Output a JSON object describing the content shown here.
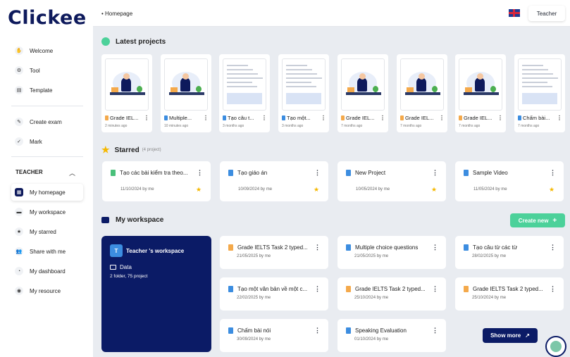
{
  "brand": {
    "logo": "Clickee"
  },
  "sidebar": {
    "top_items": [
      {
        "label": "Welcome",
        "icon": "hand-icon"
      },
      {
        "label": "Tool",
        "icon": "tool-icon"
      },
      {
        "label": "Template",
        "icon": "template-icon"
      }
    ],
    "mid_items": [
      {
        "label": "Create exam",
        "icon": "exam-icon"
      },
      {
        "label": "Mark",
        "icon": "mark-icon"
      }
    ],
    "section_title": "TEACHER",
    "teacher_items": [
      {
        "label": "My homepage",
        "icon": "grid-icon"
      },
      {
        "label": "My workspace",
        "icon": "folder-icon"
      },
      {
        "label": "My starred",
        "icon": "star-icon"
      },
      {
        "label": "Share with me",
        "icon": "users-icon"
      },
      {
        "label": "My dashboard",
        "icon": "chart-icon"
      },
      {
        "label": "My resource",
        "icon": "resource-icon"
      }
    ]
  },
  "header": {
    "breadcrumb": "Homepage",
    "role": "Teacher"
  },
  "latest": {
    "title": "Latest projects",
    "items": [
      {
        "name": "Grade IEL...",
        "time": "2 minutes ago",
        "color": "#f4a94b"
      },
      {
        "name": "Multiple...",
        "time": "10 minutes ago",
        "color": "#3c8de0"
      },
      {
        "name": "Tạo câu t...",
        "time": "3 months ago",
        "color": "#3c8de0"
      },
      {
        "name": "Tạo một...",
        "time": "3 months ago",
        "color": "#3c8de0"
      },
      {
        "name": "Grade IEL...",
        "time": "7 months ago",
        "color": "#f4a94b"
      },
      {
        "name": "Grade IEL...",
        "time": "7 months ago",
        "color": "#f4a94b"
      },
      {
        "name": "Grade IEL...",
        "time": "7 months ago",
        "color": "#f4a94b"
      },
      {
        "name": "Chấm bài...",
        "time": "7 months ago",
        "color": "#3c8de0"
      }
    ]
  },
  "starred": {
    "title": "Starred",
    "count": "(4 project)",
    "items": [
      {
        "name": "Tạo các bài kiểm tra theo...",
        "date": "11/10/2024 by me",
        "color": "#49c07a"
      },
      {
        "name": "Tạo giáo án",
        "date": "10/09/2024 by me",
        "color": "#3c8de0"
      },
      {
        "name": "New Project",
        "date": "10/05/2024 by me",
        "color": "#3c8de0"
      },
      {
        "name": "Sample Video",
        "date": "11/05/2024 by me",
        "color": "#3c8de0"
      }
    ]
  },
  "workspace": {
    "title": "My workspace",
    "create_label": "Create new",
    "show_more_label": "Show more",
    "card": {
      "avatar": "T",
      "title": "Teacher 's workspace",
      "folder": "Data",
      "count": "2 folder, 75 project"
    },
    "items": [
      {
        "name": "Grade IELTS Task 2 typed...",
        "date": "21/05/2025 by me",
        "color": "#f4a94b"
      },
      {
        "name": "Multiple choice questions",
        "date": "21/05/2025 by me",
        "color": "#3c8de0"
      },
      {
        "name": "Tạo câu từ các từ",
        "date": "28/02/2025 by me",
        "color": "#3c8de0"
      },
      {
        "name": "Tạo một văn bản về một c...",
        "date": "22/02/2025 by me",
        "color": "#3c8de0"
      },
      {
        "name": "Grade IELTS Task 2 typed...",
        "date": "25/10/2024 by me",
        "color": "#f4a94b"
      },
      {
        "name": "Grade IELTS Task 2 typed...",
        "date": "25/10/2024 by me",
        "color": "#f4a94b"
      },
      {
        "name": "Chấm bài nói",
        "date": "30/09/2024 by me",
        "color": "#3c8de0"
      },
      {
        "name": "Speaking Evaluation",
        "date": "01/10/2024 by me",
        "color": "#3c8de0"
      }
    ]
  }
}
